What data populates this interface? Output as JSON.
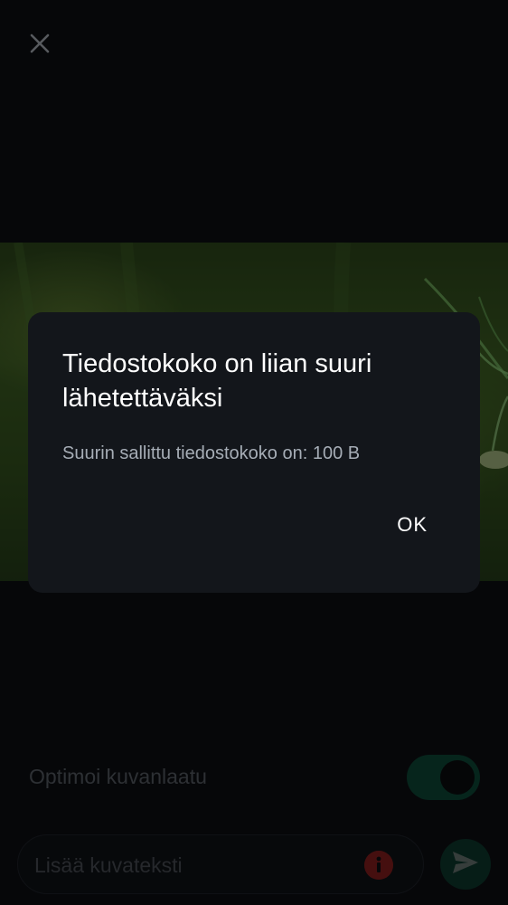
{
  "dialog": {
    "title": "Tiedostokoko on liian suuri lähetettäväksi",
    "message": "Suurin sallittu tiedostokoko on: 100 B",
    "ok_label": "OK"
  },
  "composer": {
    "optimize_label": "Optimoi kuvanlaatu",
    "optimize_enabled": true,
    "caption_placeholder": "Lisää kuvateksti",
    "caption_value": ""
  },
  "icons": {
    "close": "close-icon",
    "info": "info-icon",
    "send": "send-icon"
  },
  "colors": {
    "background": "#0d0f13",
    "dialog_bg": "#13161b",
    "toggle_on": "#0d4a39",
    "send_bg": "#0d3a2f",
    "error": "#c62828"
  }
}
